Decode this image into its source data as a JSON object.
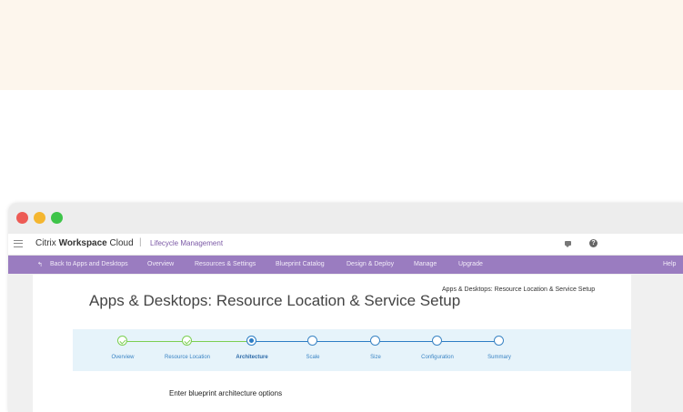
{
  "window": {
    "brand": {
      "prefix": "Citrix ",
      "strong": "Workspace",
      "suffix": " Cloud"
    },
    "separator": "|",
    "subtitle": "Lifecycle Management"
  },
  "icons": {
    "menu": "hamburger-icon",
    "chat": "chat-icon",
    "help": "help-icon",
    "back": "back-arrow-icon",
    "help_glyph": "?"
  },
  "nav": {
    "back_label": "Back to Apps and Desktops",
    "items": [
      "Overview",
      "Resources & Settings",
      "Blueprint Catalog",
      "Design & Deploy",
      "Manage",
      "Upgrade"
    ],
    "help": "Help"
  },
  "page": {
    "title": "Apps & Desktops: Resource Location & Service Setup",
    "breadcrumb": "Apps & Desktops: Resource Location & Service Setup",
    "section_heading": "Enter blueprint architecture options"
  },
  "stepper": {
    "steps": [
      {
        "label": "Overview",
        "state": "done"
      },
      {
        "label": "Resource Location",
        "state": "done"
      },
      {
        "label": "Architecture",
        "state": "current"
      },
      {
        "label": "Scale",
        "state": "todo"
      },
      {
        "label": "Size",
        "state": "todo"
      },
      {
        "label": "Configuration",
        "state": "todo"
      },
      {
        "label": "Summary",
        "state": "todo"
      }
    ]
  },
  "colors": {
    "accent_purple": "#9a7cc0",
    "done_green": "#7ccf52",
    "current_blue": "#2c7dc4",
    "stepper_bg": "#e6f3fa"
  }
}
